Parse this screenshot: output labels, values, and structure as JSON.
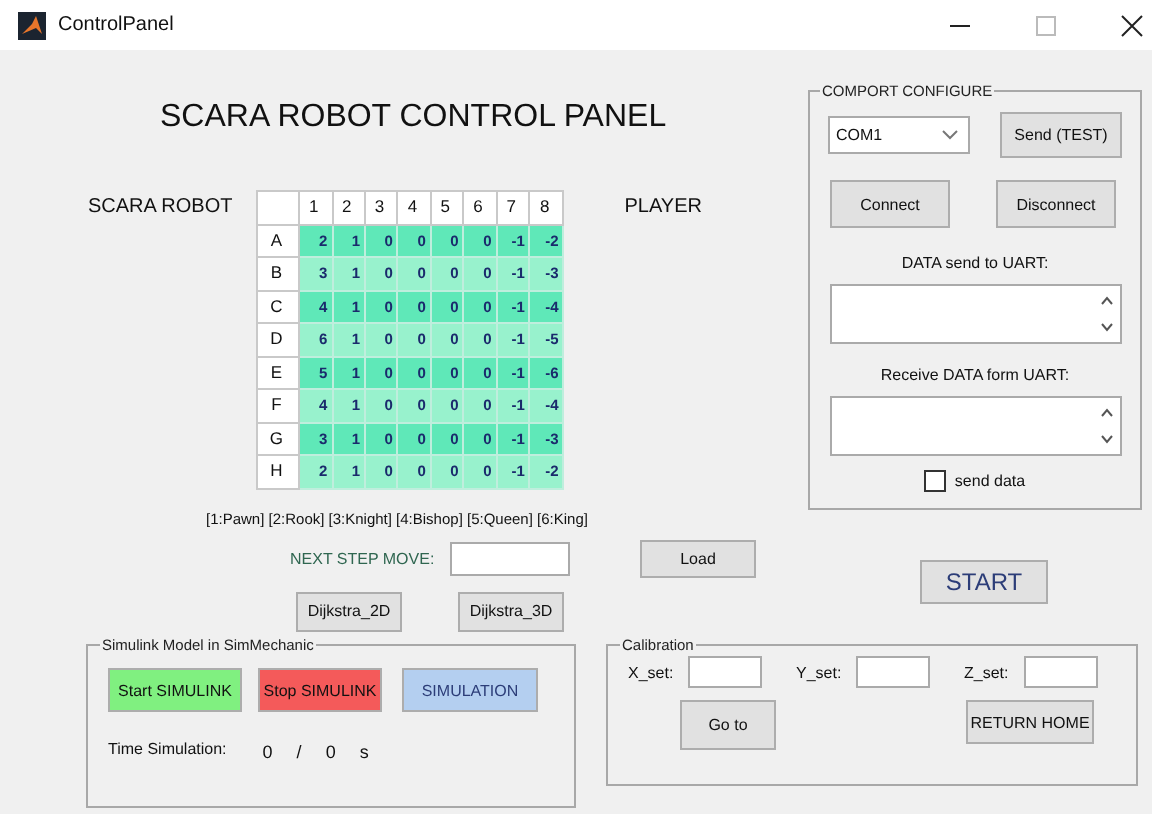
{
  "window": {
    "title": "ControlPanel"
  },
  "heading": "SCARA ROBOT CONTROL PANEL",
  "board": {
    "label": "SCARA ROBOT",
    "player_label": "PLAYER",
    "columns": [
      "1",
      "2",
      "3",
      "4",
      "5",
      "6",
      "7",
      "8"
    ],
    "rows": [
      {
        "label": "A",
        "cells": [
          "2",
          "1",
          "0",
          "0",
          "0",
          "0",
          "-1",
          "-2"
        ]
      },
      {
        "label": "B",
        "cells": [
          "3",
          "1",
          "0",
          "0",
          "0",
          "0",
          "-1",
          "-3"
        ]
      },
      {
        "label": "C",
        "cells": [
          "4",
          "1",
          "0",
          "0",
          "0",
          "0",
          "-1",
          "-4"
        ]
      },
      {
        "label": "D",
        "cells": [
          "6",
          "1",
          "0",
          "0",
          "0",
          "0",
          "-1",
          "-5"
        ]
      },
      {
        "label": "E",
        "cells": [
          "5",
          "1",
          "0",
          "0",
          "0",
          "0",
          "-1",
          "-6"
        ]
      },
      {
        "label": "F",
        "cells": [
          "4",
          "1",
          "0",
          "0",
          "0",
          "0",
          "-1",
          "-4"
        ]
      },
      {
        "label": "G",
        "cells": [
          "3",
          "1",
          "0",
          "0",
          "0",
          "0",
          "-1",
          "-3"
        ]
      },
      {
        "label": "H",
        "cells": [
          "2",
          "1",
          "0",
          "0",
          "0",
          "0",
          "-1",
          "-2"
        ]
      }
    ]
  },
  "legend": "[1:Pawn]  [2:Rook]  [3:Knight]  [4:Bishop]  [5:Queen]  [6:King]",
  "next_step": {
    "label": "NEXT STEP MOVE:",
    "load": "Load"
  },
  "path_buttons": [
    "Dijkstra_2D",
    "Dijkstra_3D"
  ],
  "comport": {
    "title": "COMPORT CONFIGURE",
    "port": "COM1",
    "send_test": "Send (TEST)",
    "connect": "Connect",
    "disconnect": "Disconnect",
    "send_label": "DATA send to UART:",
    "receive_label": "Receive DATA form UART:",
    "send_data": {
      "label": "send data",
      "checked": false
    }
  },
  "start": "START",
  "simulink": {
    "title": "Simulink Model in SimMechanic",
    "buttons": [
      {
        "label": "Start SIMULINK",
        "color": "#80f080"
      },
      {
        "label": "Stop SIMULINK",
        "color": "#f45a5a"
      },
      {
        "label": "SIMULATION",
        "color": "#b4cff0"
      }
    ],
    "time": {
      "label": "Time Simulation:",
      "current": "0",
      "separator": "/",
      "total": "0",
      "unit": "s"
    }
  },
  "calibration": {
    "title": "Calibration",
    "fields": [
      {
        "label": "X_set:"
      },
      {
        "label": "Y_set:"
      },
      {
        "label": "Z_set:"
      }
    ],
    "go": "Go to",
    "home": "RETURN HOME"
  }
}
